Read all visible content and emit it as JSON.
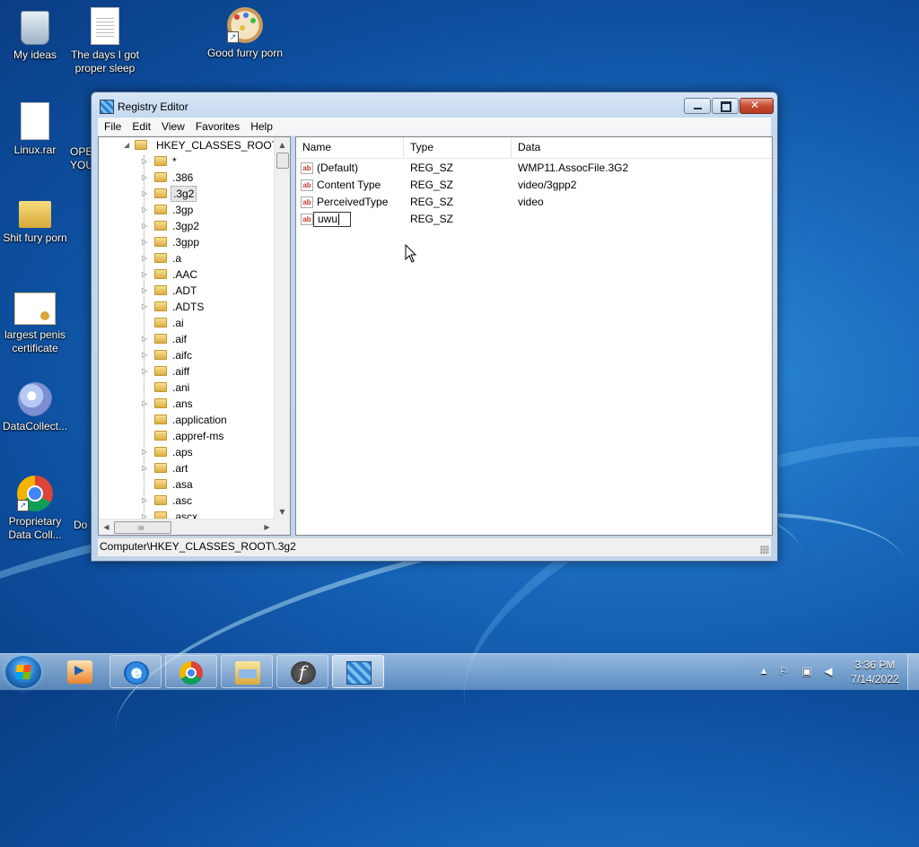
{
  "desktop": {
    "icons": [
      {
        "label": "My ideas",
        "icon": "recycle-bin-icon"
      },
      {
        "label": "The days I got proper sleep",
        "icon": "text-document-icon"
      },
      {
        "label": "Good furry porn",
        "icon": "paint-shortcut-icon"
      },
      {
        "label": "Linux.rar",
        "icon": "archive-file-icon"
      },
      {
        "label": "OPE YOU",
        "icon": "partially-hidden-icon"
      },
      {
        "label": "Shit fury porn",
        "icon": "media-folder-icon"
      },
      {
        "label": "largest penis certificate",
        "icon": "certificate-icon"
      },
      {
        "label": "DataCollect...",
        "icon": "data-collector-icon"
      },
      {
        "label": "Proprietary Data Coll...",
        "icon": "chrome-shortcut-icon"
      },
      {
        "label": "Do",
        "icon": "partially-hidden-icon"
      }
    ]
  },
  "window": {
    "title": "Registry Editor",
    "menu": [
      "File",
      "Edit",
      "View",
      "Favorites",
      "Help"
    ],
    "tree": {
      "root": "HKEY_CLASSES_ROOT",
      "selected": ".3g2",
      "items": [
        {
          "label": "*",
          "expandable": true
        },
        {
          "label": ".386",
          "expandable": true
        },
        {
          "label": ".3g2",
          "expandable": true
        },
        {
          "label": ".3gp",
          "expandable": true
        },
        {
          "label": ".3gp2",
          "expandable": true
        },
        {
          "label": ".3gpp",
          "expandable": true
        },
        {
          "label": ".a",
          "expandable": true
        },
        {
          "label": ".AAC",
          "expandable": true
        },
        {
          "label": ".ADT",
          "expandable": true
        },
        {
          "label": ".ADTS",
          "expandable": true
        },
        {
          "label": ".ai",
          "expandable": false
        },
        {
          "label": ".aif",
          "expandable": true
        },
        {
          "label": ".aifc",
          "expandable": true
        },
        {
          "label": ".aiff",
          "expandable": true
        },
        {
          "label": ".ani",
          "expandable": false
        },
        {
          "label": ".ans",
          "expandable": true
        },
        {
          "label": ".application",
          "expandable": false
        },
        {
          "label": ".appref-ms",
          "expandable": false
        },
        {
          "label": ".aps",
          "expandable": true
        },
        {
          "label": ".art",
          "expandable": true
        },
        {
          "label": ".asa",
          "expandable": false
        },
        {
          "label": ".asc",
          "expandable": true
        },
        {
          "label": ".ascx",
          "expandable": true
        }
      ]
    },
    "list": {
      "columns": [
        "Name",
        "Type",
        "Data"
      ],
      "rows": [
        {
          "name": "(Default)",
          "type": "REG_SZ",
          "data": "WMP11.AssocFile.3G2"
        },
        {
          "name": "Content Type",
          "type": "REG_SZ",
          "data": "video/3gpp2"
        },
        {
          "name": "PerceivedType",
          "type": "REG_SZ",
          "data": "video"
        },
        {
          "name": "uwu",
          "type": "REG_SZ",
          "data": "",
          "editing": true
        }
      ]
    },
    "status": "Computer\\HKEY_CLASSES_ROOT\\.3g2",
    "scroll_grip": "III"
  },
  "taskbar": {
    "apps": [
      {
        "name": "windows-media-player",
        "state": "pinned"
      },
      {
        "name": "internet-explorer",
        "state": "running"
      },
      {
        "name": "google-chrome",
        "state": "running"
      },
      {
        "name": "windows-explorer",
        "state": "running"
      },
      {
        "name": "adobe-flash",
        "state": "running"
      },
      {
        "name": "registry-editor",
        "state": "active"
      }
    ],
    "tray_icons": [
      "show-hidden-icons-icon",
      "action-center-flag-icon",
      "network-icon",
      "volume-muted-icon"
    ],
    "tray_glyphs": [
      "▲",
      "⚐",
      "▣",
      "◀"
    ],
    "time": "3:36 PM",
    "date": "7/14/2022"
  },
  "colors": {
    "selection_tint": "#e6e6e6",
    "close_button": "#c84a32",
    "wallpaper_blue": "#1a6bbf"
  }
}
